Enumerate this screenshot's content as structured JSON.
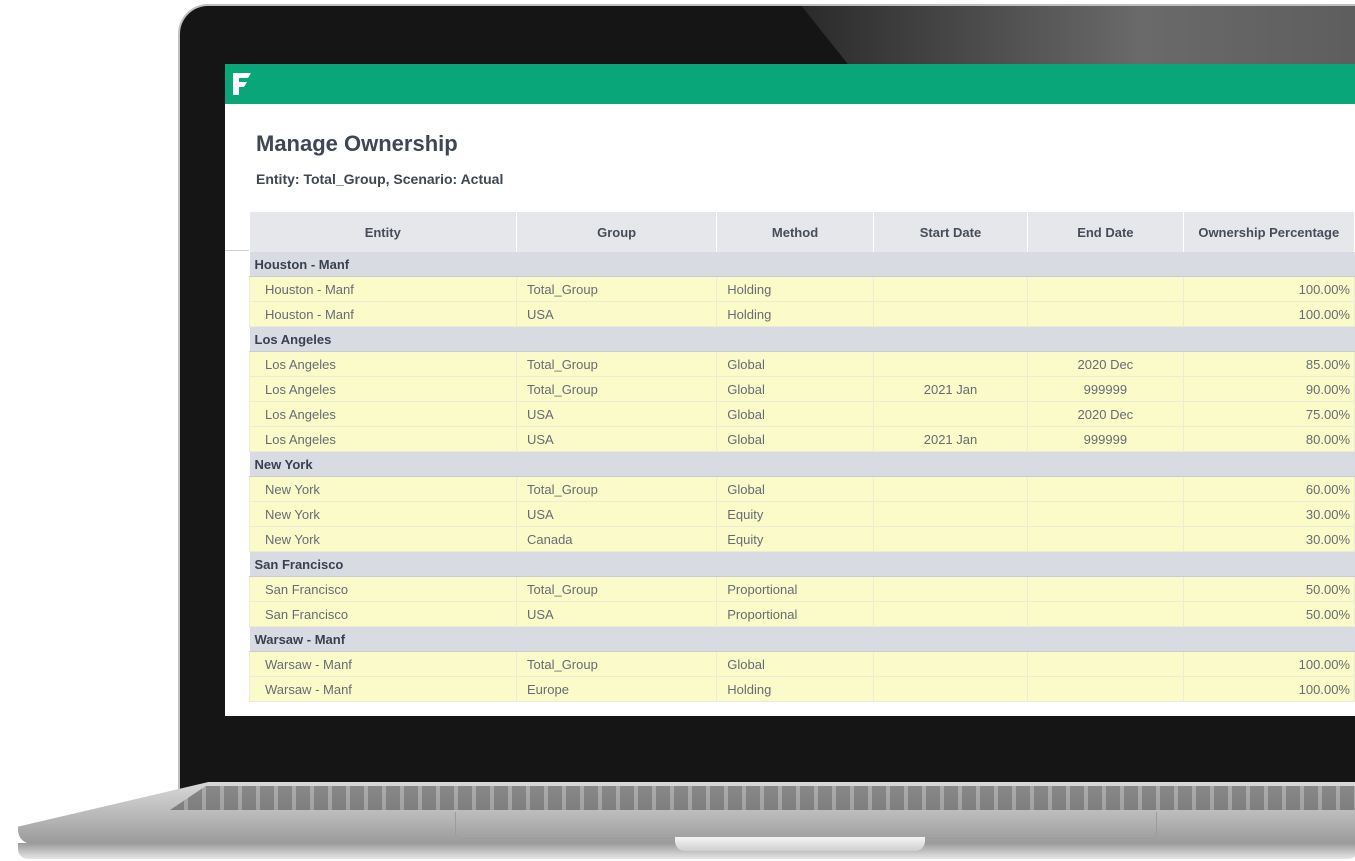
{
  "app": {
    "brand_color": "#09a67a",
    "logo_icon": "f-logo-icon"
  },
  "page": {
    "title": "Manage Ownership",
    "subtitle": "Entity: Total_Group, Scenario: Actual"
  },
  "table": {
    "columns": [
      "Entity",
      "Group",
      "Method",
      "Start Date",
      "End Date",
      "Ownership Percentage"
    ],
    "groups": [
      {
        "label": "Houston - Manf",
        "rows": [
          {
            "entity": "Houston - Manf",
            "group": "Total_Group",
            "method": "Holding",
            "start": "",
            "end": "",
            "pct": "100.00%"
          },
          {
            "entity": "Houston - Manf",
            "group": "USA",
            "method": "Holding",
            "start": "",
            "end": "",
            "pct": "100.00%"
          }
        ]
      },
      {
        "label": "Los Angeles",
        "rows": [
          {
            "entity": "Los Angeles",
            "group": "Total_Group",
            "method": "Global",
            "start": "",
            "end": "2020 Dec",
            "pct": "85.00%"
          },
          {
            "entity": "Los Angeles",
            "group": "Total_Group",
            "method": "Global",
            "start": "2021 Jan",
            "end": "999999",
            "pct": "90.00%"
          },
          {
            "entity": "Los Angeles",
            "group": "USA",
            "method": "Global",
            "start": "",
            "end": "2020 Dec",
            "pct": "75.00%"
          },
          {
            "entity": "Los Angeles",
            "group": "USA",
            "method": "Global",
            "start": "2021 Jan",
            "end": "999999",
            "pct": "80.00%"
          }
        ]
      },
      {
        "label": "New York",
        "rows": [
          {
            "entity": "New York",
            "group": "Total_Group",
            "method": "Global",
            "start": "",
            "end": "",
            "pct": "60.00%"
          },
          {
            "entity": "New York",
            "group": "USA",
            "method": "Equity",
            "start": "",
            "end": "",
            "pct": "30.00%"
          },
          {
            "entity": "New York",
            "group": "Canada",
            "method": "Equity",
            "start": "",
            "end": "",
            "pct": "30.00%"
          }
        ]
      },
      {
        "label": "San Francisco",
        "rows": [
          {
            "entity": "San Francisco",
            "group": "Total_Group",
            "method": "Proportional",
            "start": "",
            "end": "",
            "pct": "50.00%"
          },
          {
            "entity": "San Francisco",
            "group": "USA",
            "method": "Proportional",
            "start": "",
            "end": "",
            "pct": "50.00%"
          }
        ]
      },
      {
        "label": "Warsaw - Manf",
        "rows": [
          {
            "entity": "Warsaw - Manf",
            "group": "Total_Group",
            "method": "Global",
            "start": "",
            "end": "",
            "pct": "100.00%"
          },
          {
            "entity": "Warsaw - Manf",
            "group": "Europe",
            "method": "Holding",
            "start": "",
            "end": "",
            "pct": "100.00%"
          }
        ]
      }
    ]
  }
}
